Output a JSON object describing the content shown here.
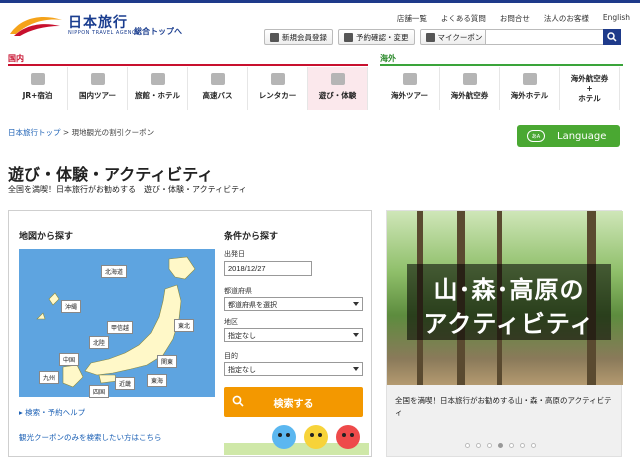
{
  "logo": {
    "name": "日本旅行",
    "sub": "NIPPON TRAVEL AGENCY",
    "totop": "総合トップへ"
  },
  "utility_links": [
    "店舗一覧",
    "よくある質問",
    "お問合せ",
    "法人のお客様",
    "English"
  ],
  "actions": [
    {
      "label": "新規会員登録",
      "icon": "pencil-icon"
    },
    {
      "label": "予約確認・変更",
      "icon": "person-icon"
    },
    {
      "label": "マイクーポン",
      "icon": "coupon-icon"
    }
  ],
  "search": {
    "placeholder": "",
    "icon": "search-icon"
  },
  "sections": {
    "domestic": "国内",
    "overseas": "海外"
  },
  "colors": {
    "domestic": "#c8102e",
    "overseas": "#3aa43a",
    "accent": "#1e3a8a",
    "search_button": "#f39800",
    "language": "#4aa832"
  },
  "nav_domestic": [
    {
      "label": "JR+宿泊",
      "icon": "train-icon"
    },
    {
      "label": "国内ツアー",
      "icon": "plane-icon"
    },
    {
      "label": "旅館・ホテル",
      "icon": "hotel-icon"
    },
    {
      "label": "高速バス",
      "icon": "bus-icon"
    },
    {
      "label": "レンタカー",
      "icon": "car-icon"
    },
    {
      "label": "遊び・体験",
      "icon": "ticket-icon",
      "active": true
    }
  ],
  "nav_overseas": [
    {
      "label": "海外ツアー",
      "icon": "globe-icon"
    },
    {
      "label": "海外航空券",
      "icon": "airplane-icon"
    },
    {
      "label": "海外ホテル",
      "icon": "building-icon"
    },
    {
      "label": "海外航空券\n+\nホテル",
      "icon": ""
    }
  ],
  "breadcrumb": {
    "home": "日本旅行トップ",
    "sep": ">",
    "current": "現地観光の割引クーポン"
  },
  "language_button": {
    "bubble": "あA",
    "label": "Language"
  },
  "page": {
    "title": "遊び・体験・アクティビティ",
    "subtitle": "全国を満喫！日本旅行がお勧めする　遊び・体験・アクティビティ"
  },
  "map_search": {
    "heading": "地図から探す",
    "regions": [
      "北海道",
      "沖縄",
      "甲信越",
      "北陸",
      "東北",
      "中国",
      "関東",
      "九州",
      "近畿",
      "東海",
      "四国"
    ],
    "help_link": "検索・予約ヘルプ",
    "coupon_link": "観光クーポンのみを検索したい方はこちら"
  },
  "cond_search": {
    "heading": "条件から探す",
    "date_label": "出発日",
    "date_value": "2018/12/27",
    "pref_label": "都道府県",
    "pref_value": "都道府県を選択",
    "area_label": "地区",
    "area_value": "指定なし",
    "purpose_label": "目的",
    "purpose_value": "指定なし",
    "button": "検索する"
  },
  "banner": {
    "line1": "山･森･高原の",
    "line2": "アクティビティ",
    "caption": "全国を満喫！日本旅行がお勧めする山・森・高原のアクティビティ",
    "dots": 7,
    "active_dot": 3
  }
}
